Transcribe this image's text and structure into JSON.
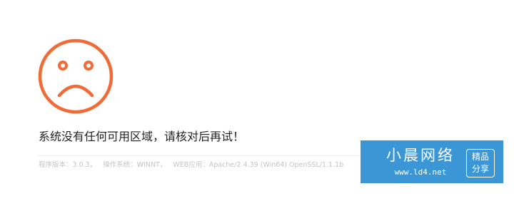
{
  "error": {
    "icon": "sad-face-icon",
    "message": "系统没有任何可用区域，请核对后再试！",
    "accent_color": "#f26a35"
  },
  "server_info": {
    "version": "程序版本：3.0.3，",
    "os": "操作系统：WINNT，",
    "web_server": "WEB应用：Apache/2.4.39 (Win64) OpenSSL/1.1.1b"
  },
  "watermark": {
    "title": "小晨网络",
    "url": "www.ld4.net",
    "badge_line1": "精品",
    "badge_line2": "分享",
    "background_color": "#3b96d6"
  }
}
